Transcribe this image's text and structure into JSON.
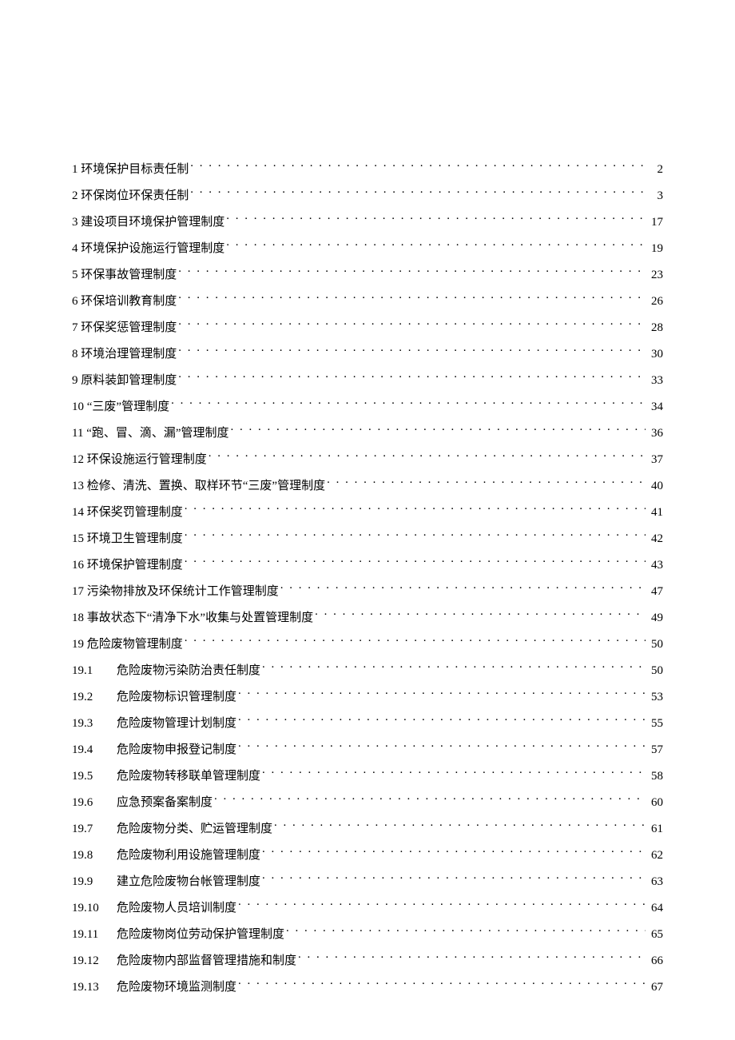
{
  "toc": [
    {
      "level": 1,
      "num": "1",
      "title": "环境保护目标责任制",
      "page": "2"
    },
    {
      "level": 1,
      "num": "2",
      "title": "环保岗位环保责任制",
      "page": "3"
    },
    {
      "level": 1,
      "num": "3",
      "title": "建设项目环境保护管理制度",
      "page": "17"
    },
    {
      "level": 1,
      "num": "4",
      "title": "环境保护设施运行管理制度",
      "page": "19"
    },
    {
      "level": 1,
      "num": "5",
      "title": "环保事故管理制度",
      "page": "23"
    },
    {
      "level": 1,
      "num": "6",
      "title": "环保培训教育制度",
      "page": "26"
    },
    {
      "level": 1,
      "num": "7",
      "title": "环保奖惩管理制度",
      "page": "28"
    },
    {
      "level": 1,
      "num": "8",
      "title": "环境治理管理制度",
      "page": "30"
    },
    {
      "level": 1,
      "num": "9",
      "title": "原料装卸管理制度",
      "page": "33"
    },
    {
      "level": 1,
      "num": "10",
      "title": "“三废”管理制度",
      "page": "34"
    },
    {
      "level": 1,
      "num": "11",
      "title": "“跑、冒、滴、漏”管理制度",
      "page": "36"
    },
    {
      "level": 1,
      "num": "12",
      "title": "环保设施运行管理制度",
      "page": "37"
    },
    {
      "level": 1,
      "num": "13",
      "title": "检修、清洗、置换、取样环节“三废”管理制度",
      "page": "40"
    },
    {
      "level": 1,
      "num": "14",
      "title": "环保奖罚管理制度",
      "page": "41"
    },
    {
      "level": 1,
      "num": "15",
      "title": "环境卫生管理制度",
      "page": "42"
    },
    {
      "level": 1,
      "num": "16",
      "title": "环境保护管理制度",
      "page": "43"
    },
    {
      "level": 1,
      "num": "17",
      "title": "污染物排放及环保统计工作管理制度",
      "page": "47"
    },
    {
      "level": 1,
      "num": "18",
      "title": "事故状态下“清净下水”收集与处置管理制度",
      "page": "49"
    },
    {
      "level": 1,
      "num": "19",
      "title": "危险废物管理制度",
      "page": "50"
    },
    {
      "level": 2,
      "num": "19.1",
      "title": "危险废物污染防治责任制度",
      "page": "50"
    },
    {
      "level": 2,
      "num": "19.2",
      "title": "危险废物标识管理制度",
      "page": "53"
    },
    {
      "level": 2,
      "num": "19.3",
      "title": "危险废物管理计划制度",
      "page": "55"
    },
    {
      "level": 2,
      "num": "19.4",
      "title": "危险废物申报登记制度",
      "page": "57"
    },
    {
      "level": 2,
      "num": "19.5",
      "title": "危险废物转移联单管理制度",
      "page": "58"
    },
    {
      "level": 2,
      "num": "19.6",
      "title": "应急预案备案制度",
      "page": "60"
    },
    {
      "level": 2,
      "num": "19.7",
      "title": "危险废物分类、贮运管理制度",
      "page": "61"
    },
    {
      "level": 2,
      "num": "19.8",
      "title": "危险废物利用设施管理制度",
      "page": "62"
    },
    {
      "level": 2,
      "num": "19.9",
      "title": "建立危险废物台帐管理制度",
      "page": "63"
    },
    {
      "level": 2,
      "num": "19.10",
      "title": "危险废物人员培训制度",
      "page": "64"
    },
    {
      "level": 2,
      "num": "19.11",
      "title": "危险废物岗位劳动保护管理制度",
      "page": "65"
    },
    {
      "level": 2,
      "num": "19.12",
      "title": "危险废物内部监督管理措施和制度",
      "page": "66"
    },
    {
      "level": 2,
      "num": "19.13",
      "title": "危险废物环境监测制度",
      "page": "67"
    }
  ]
}
